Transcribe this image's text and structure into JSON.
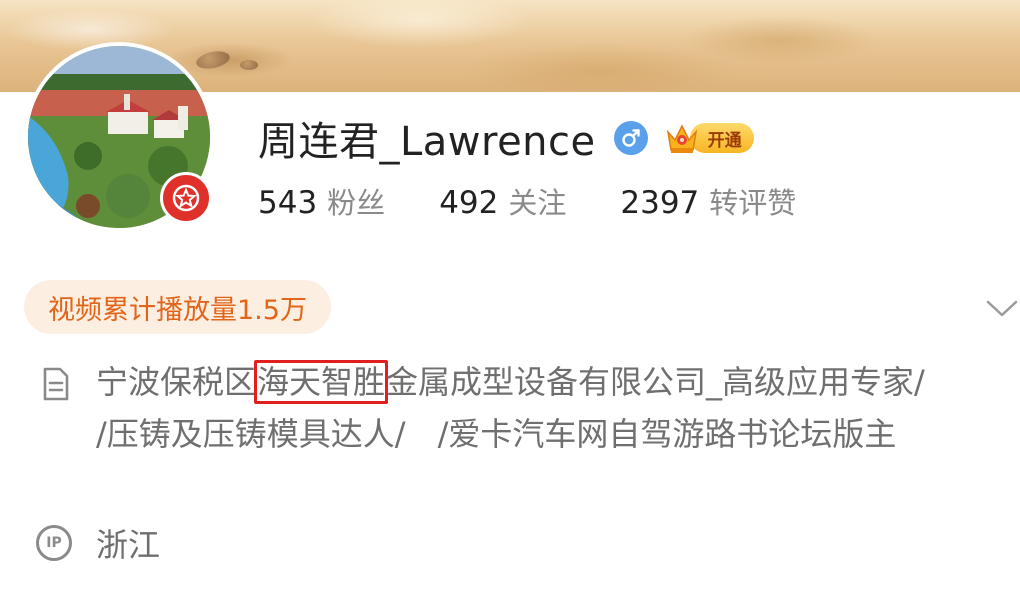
{
  "profile": {
    "name": "周连君_Lawrence",
    "vip_label": "开通"
  },
  "stats": [
    {
      "value": "543",
      "label": "粉丝"
    },
    {
      "value": "492",
      "label": "关注"
    },
    {
      "value": "2397",
      "label": "转评赞"
    }
  ],
  "play_count_label": "视频累计播放量1.5万",
  "description": {
    "before_highlight": "宁波保税区",
    "highlight": "海天智胜",
    "after_highlight": "金属成型设备有限公司_高级应用专家/　/压铸及压铸模具达人/　/爱卡汽车网自驾游路书论坛版主"
  },
  "location": {
    "ip_icon_text": "IP",
    "value": "浙江"
  },
  "colors": {
    "play_pill_bg": "#fdeee2",
    "play_pill_text": "#e2651a",
    "gender_badge": "#5aa0ea",
    "avatar_badge": "#e0302a",
    "highlight_border": "#e01f1f"
  },
  "icons": {
    "gender": "male-icon",
    "vip": "crown-icon",
    "avatar_badge": "star-badge-icon",
    "expand": "chevron-down-icon",
    "description": "document-icon",
    "location": "ip-icon"
  }
}
